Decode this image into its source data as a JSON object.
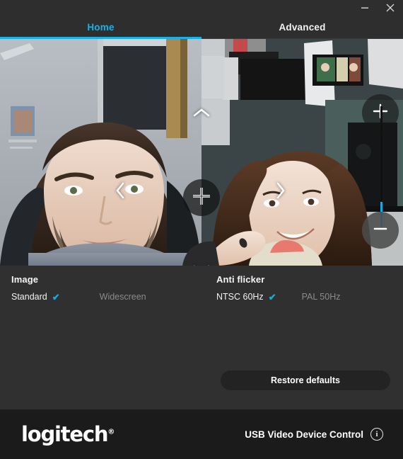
{
  "window": {
    "minimize_label": "–",
    "close_label": "×",
    "minimize_icon": "minimize-icon",
    "close_icon": "close-icon"
  },
  "tabs": [
    {
      "label": "Home",
      "active": true
    },
    {
      "label": "Advanced",
      "active": false
    }
  ],
  "video": {
    "overlay": {
      "pan_up_icon": "chevron-up-icon",
      "pan_down_icon": "chevron-down-icon",
      "pan_left_icon": "chevron-left-icon",
      "pan_right_icon": "chevron-right-icon",
      "center_icon": "crosshair-icon",
      "zoom_in_icon": "plus-icon",
      "zoom_out_icon": "minus-icon",
      "zoom_slider_name": "zoom-slider",
      "zoom_fill_top_pct": 78,
      "zoom_fill_height_pct": 22
    },
    "accent": "#19a9e0"
  },
  "settings": {
    "groups": [
      {
        "title": "Image",
        "options": [
          {
            "label": "Standard",
            "selected": true
          },
          {
            "label": "Widescreen",
            "selected": false
          }
        ]
      },
      {
        "title": "Anti flicker",
        "options": [
          {
            "label": "NTSC 60Hz",
            "selected": true
          },
          {
            "label": "PAL 50Hz",
            "selected": false
          }
        ]
      }
    ],
    "check_glyph": "✔",
    "restore_label": "Restore defaults"
  },
  "footer": {
    "brand": "logitech",
    "brand_mark": "®",
    "product_label": "USB Video Device Control",
    "info_glyph": "i",
    "info_icon": "info-icon"
  },
  "colors": {
    "accent": "#19a9e0",
    "panel": "#303030",
    "titlebar": "#2e2e2e",
    "footer": "#1b1b1b",
    "text": "#f2f2f2",
    "text_dim": "#8b8b8b"
  }
}
